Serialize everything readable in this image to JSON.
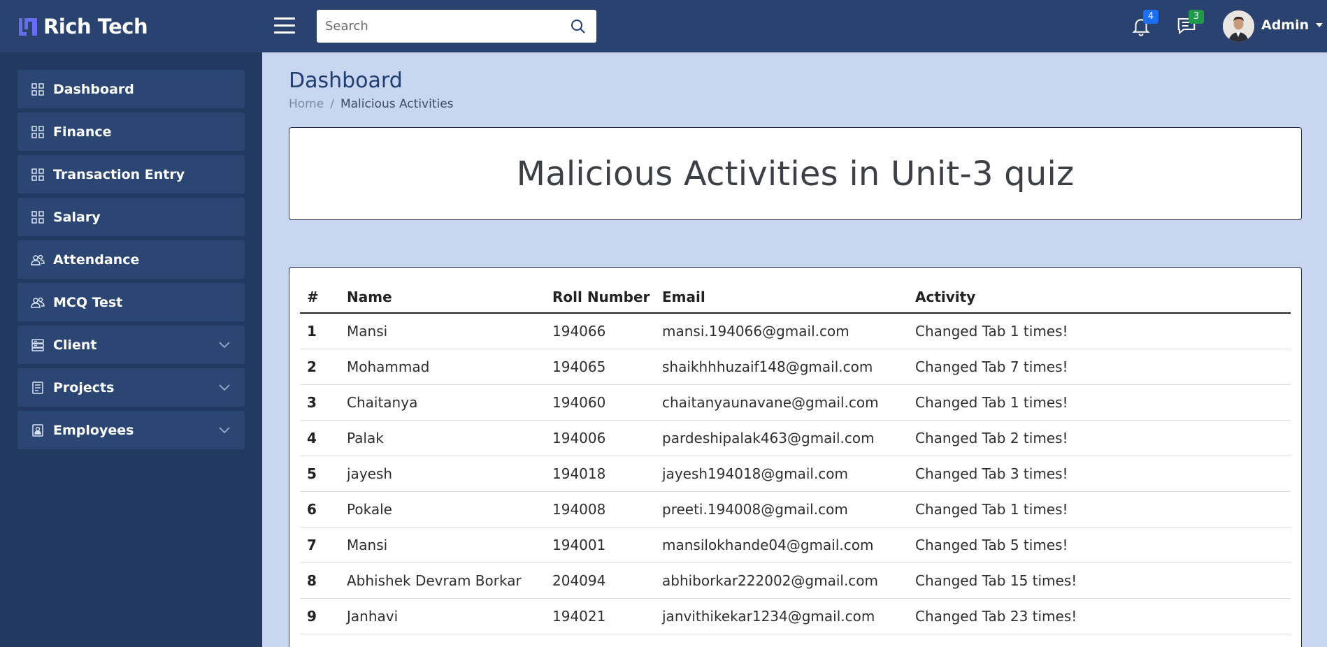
{
  "brand": {
    "name": "Rich Tech",
    "accent": "#6a6cf0"
  },
  "search": {
    "placeholder": "Search"
  },
  "header": {
    "notifications_count": "4",
    "notifications_badge_color": "#1b6ff5",
    "messages_count": "3",
    "messages_badge_color": "#1e9a48",
    "user_name": "Admin"
  },
  "sidebar": {
    "items": [
      {
        "label": "Dashboard",
        "icon": "grid-icon"
      },
      {
        "label": "Finance",
        "icon": "grid-icon"
      },
      {
        "label": "Transaction Entry",
        "icon": "grid-icon"
      },
      {
        "label": "Salary",
        "icon": "grid-icon"
      },
      {
        "label": "Attendance",
        "icon": "users-icon"
      },
      {
        "label": "MCQ Test",
        "icon": "users-icon"
      },
      {
        "label": "Client",
        "icon": "server-icon",
        "expandable": true
      },
      {
        "label": "Projects",
        "icon": "document-icon",
        "expandable": true
      },
      {
        "label": "Employees",
        "icon": "badge-icon",
        "expandable": true
      }
    ]
  },
  "page": {
    "title": "Dashboard",
    "breadcrumb": {
      "home": "Home",
      "separator": "/",
      "current": "Malicious Activities"
    },
    "heading": "Malicious Activities in Unit-3 quiz"
  },
  "table": {
    "headers": [
      "#",
      "Name",
      "Roll Number",
      "Email",
      "Activity"
    ],
    "rows": [
      [
        "1",
        "Mansi",
        "194066",
        "mansi.194066@gmail.com",
        "Changed Tab 1 times!"
      ],
      [
        "2",
        "Mohammad",
        "194065",
        "shaikhhhuzaif148@gmail.com",
        "Changed Tab 7 times!"
      ],
      [
        "3",
        "Chaitanya",
        "194060",
        "chaitanyaunavane@gmail.com",
        "Changed Tab 1 times!"
      ],
      [
        "4",
        "Palak",
        "194006",
        "pardeshipalak463@gmail.com",
        "Changed Tab 2 times!"
      ],
      [
        "5",
        "jayesh",
        "194018",
        "jayesh194018@gmail.com",
        "Changed Tab 3 times!"
      ],
      [
        "6",
        "Pokale",
        "194008",
        "preeti.194008@gmail.com",
        "Changed Tab 1 times!"
      ],
      [
        "7",
        "Mansi",
        "194001",
        "mansilokhande04@gmail.com",
        "Changed Tab 5 times!"
      ],
      [
        "8",
        "Abhishek Devram Borkar",
        "204094",
        "abhiborkar222002@gmail.com",
        "Changed Tab 15 times!"
      ],
      [
        "9",
        "Janhavi",
        "194021",
        "janvithikekar1234@gmail.com",
        "Changed Tab 23 times!"
      ]
    ]
  }
}
